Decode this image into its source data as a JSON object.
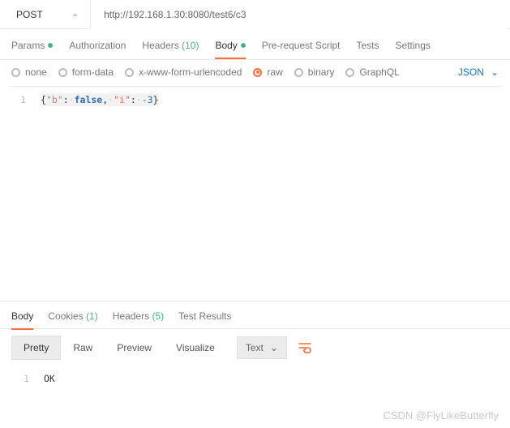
{
  "request": {
    "method": "POST",
    "url": "http://192.168.1.30:8080/test6/c3"
  },
  "tabs": {
    "params": {
      "label": "Params"
    },
    "auth": {
      "label": "Authorization"
    },
    "headers": {
      "label": "Headers",
      "count": "(10)"
    },
    "body": {
      "label": "Body"
    },
    "prereq": {
      "label": "Pre-request Script"
    },
    "tests": {
      "label": "Tests"
    },
    "settings": {
      "label": "Settings"
    }
  },
  "body_types": {
    "none": "none",
    "form": "form-data",
    "xurl": "x-www-form-urlencoded",
    "raw": "raw",
    "binary": "binary",
    "gql": "GraphQL",
    "format": "JSON"
  },
  "editor": {
    "line_no": "1",
    "tokens": {
      "open": "{",
      "k1": "\"b\"",
      "colon": ":",
      "sp": "·",
      "v1": "false",
      "comma": ",",
      "k2": "\"i\"",
      "v2": "-3",
      "close": "}"
    }
  },
  "response": {
    "tabs": {
      "body": "Body",
      "cookies": {
        "label": "Cookies",
        "count": "(1)"
      },
      "headers": {
        "label": "Headers",
        "count": "(5)"
      },
      "tests": "Test Results"
    },
    "views": {
      "pretty": "Pretty",
      "raw": "Raw",
      "preview": "Preview",
      "visualize": "Visualize",
      "fmt": "Text"
    },
    "line_no": "1",
    "text": "OK"
  },
  "watermark": "CSDN @FlyLikeButterfly"
}
